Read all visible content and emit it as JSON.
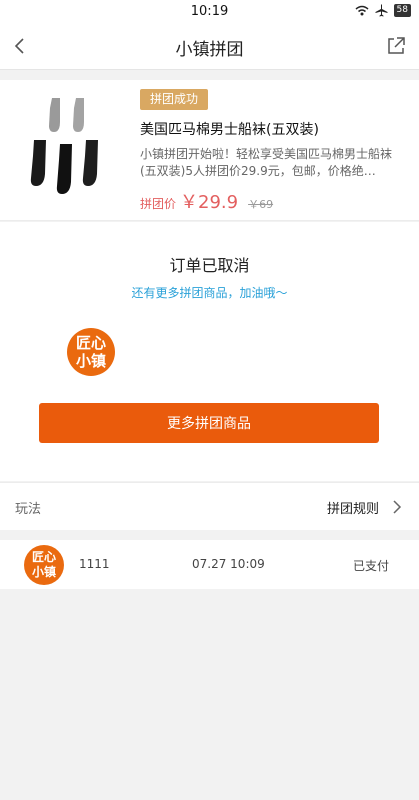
{
  "status_bar": {
    "time": "10:19",
    "battery": "58"
  },
  "nav": {
    "title": "小镇拼团",
    "back_icon": "chevron-left-icon",
    "share_icon": "share-external-icon"
  },
  "product": {
    "badge": "拼团成功",
    "title": "美国匹马棉男士船袜(五双装)",
    "description": "小镇拼团开始啦！轻松享受美国匹马棉男士船袜(五双装)5人拼团价29.9元，包邮，价格绝…",
    "price_label": "拼团价",
    "price": "￥29.9",
    "original_price": "￥69"
  },
  "order": {
    "status_title": "订单已取消",
    "status_sub": "还有更多拼团商品，加油哦～",
    "avatar_text": "匠心\n小镇",
    "more_button": "更多拼团商品"
  },
  "rules": {
    "left_label": "玩法",
    "right_label": "拼团规则"
  },
  "member": {
    "avatar_text": "匠心\n小镇",
    "name": "1111",
    "time": "07.27 10:09",
    "status": "已支付"
  },
  "colors": {
    "accent": "#ea5b0c",
    "badge": "#d9a862",
    "price": "#e35f5f",
    "link": "#2aa1d8"
  }
}
